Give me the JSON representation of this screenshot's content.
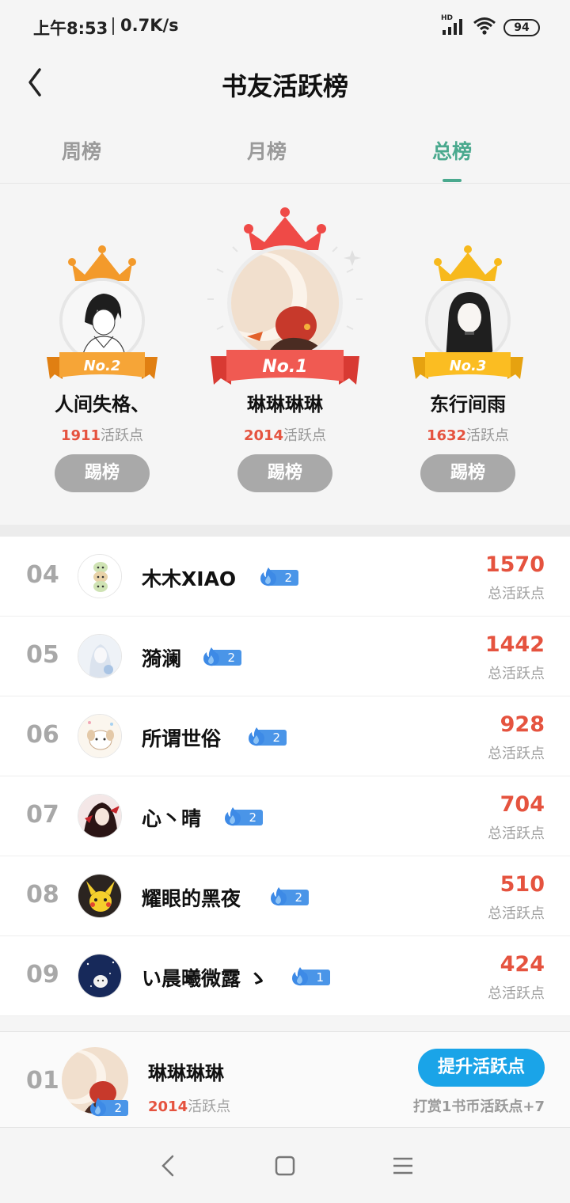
{
  "status_bar": {
    "time": "上午8:53",
    "net_speed": "0.7K/s",
    "network_label": "HD",
    "battery": "94"
  },
  "header": {
    "title": "书友活跃榜"
  },
  "tabs": [
    {
      "label": "周榜",
      "active": false
    },
    {
      "label": "月榜",
      "active": false
    },
    {
      "label": "总榜",
      "active": true
    }
  ],
  "podium": {
    "second": {
      "badge": "No.2",
      "name": "人间失格、",
      "points": "1911",
      "points_unit": "活跃点",
      "button": "踢榜"
    },
    "first": {
      "badge": "No.1",
      "name": "琳琳琳琳",
      "points": "2014",
      "points_unit": "活跃点",
      "button": "踢榜"
    },
    "third": {
      "badge": "No.3",
      "name": "东行间雨",
      "points": "1632",
      "points_unit": "活跃点",
      "button": "踢榜"
    }
  },
  "list": [
    {
      "rank": "04",
      "name": "木木XIAO",
      "level": "2",
      "score": "1570",
      "score_label": "总活跃点"
    },
    {
      "rank": "05",
      "name": "漪澜",
      "level": "2",
      "score": "1442",
      "score_label": "总活跃点"
    },
    {
      "rank": "06",
      "name": "所谓世俗",
      "level": "2",
      "score": "928",
      "score_label": "总活跃点"
    },
    {
      "rank": "07",
      "name": "心丶晴",
      "level": "2",
      "score": "704",
      "score_label": "总活跃点"
    },
    {
      "rank": "08",
      "name": "耀眼的黑夜",
      "level": "2",
      "score": "510",
      "score_label": "总活跃点"
    },
    {
      "rank": "09",
      "name": "い晨曦微露 ゝ",
      "level": "1",
      "score": "424",
      "score_label": "总活跃点"
    }
  ],
  "my_rank": {
    "rank": "01",
    "name": "琳琳琳琳",
    "level": "2",
    "points": "2014",
    "points_unit": "活跃点",
    "button": "提升活跃点",
    "hint": "打赏1书币活跃点+7"
  },
  "colors": {
    "accent": "#4aa98e",
    "score": "#e5533f",
    "boost": "#1aa4e8",
    "level_badge": "#4a95e8"
  }
}
